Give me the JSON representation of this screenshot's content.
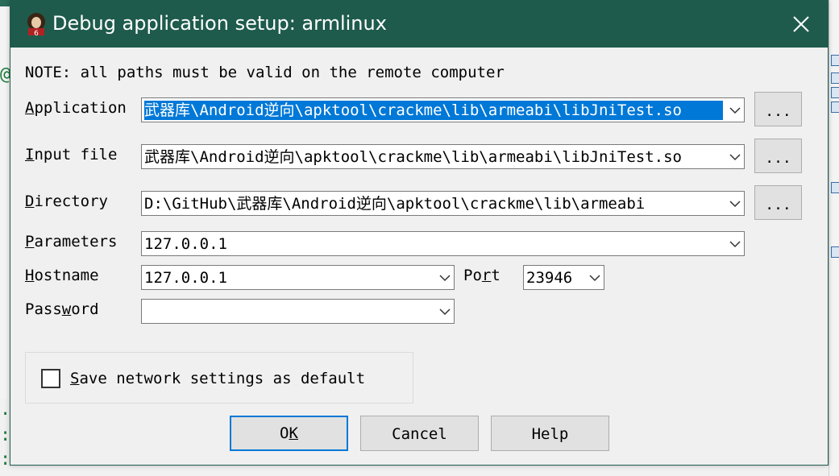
{
  "window": {
    "title": "Debug application setup: armlinux",
    "app_icon": "ida-pro-icon",
    "close_icon": "close-icon"
  },
  "note": "NOTE: all paths must be valid on the remote computer",
  "fields": {
    "application": {
      "label_pre": "",
      "label_accel": "A",
      "label_post": "pplication",
      "value": "武器库\\Android逆向\\apktool\\crackme\\lib\\armeabi\\libJniTest.so",
      "browse_label": "..."
    },
    "input_file": {
      "label_pre": "",
      "label_accel": "I",
      "label_post": "nput file",
      "value": "武器库\\Android逆向\\apktool\\crackme\\lib\\armeabi\\libJniTest.so",
      "browse_label": "..."
    },
    "directory": {
      "label_pre": "",
      "label_accel": "D",
      "label_post": "irectory",
      "value": "D:\\GitHub\\武器库\\Android逆向\\apktool\\crackme\\lib\\armeabi",
      "browse_label": "..."
    },
    "parameters": {
      "label_pre": "",
      "label_accel": "P",
      "label_post": "arameters",
      "value": "127.0.0.1"
    },
    "hostname": {
      "label_pre": "",
      "label_accel": "H",
      "label_post": "ostname",
      "value": "127.0.0.1"
    },
    "port": {
      "label_pre": "Po",
      "label_accel": "r",
      "label_post": "t",
      "value": "23946"
    },
    "password": {
      "label_pre": "Pass",
      "label_accel": "w",
      "label_post": "ord",
      "value": ""
    }
  },
  "save_network": {
    "label_pre": "",
    "label_accel": "S",
    "label_post": "ave network settings as default",
    "checked": false
  },
  "buttons": {
    "ok_pre": "O",
    "ok_accel": "K",
    "cancel": "Cancel",
    "help": "Help"
  },
  "colors": {
    "titlebar": "#1e5b4c",
    "selection": "#0078d7",
    "dialog_bg": "#f0f0f0"
  }
}
